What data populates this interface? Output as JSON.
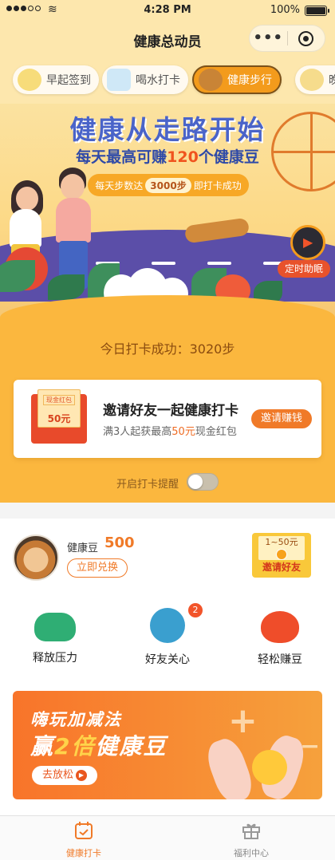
{
  "status_bar": {
    "time": "4:28 PM",
    "battery": "100%"
  },
  "nav": {
    "title": "健康总动员",
    "more_label": "•••"
  },
  "tabs": [
    {
      "label": "早起签到",
      "active": false
    },
    {
      "label": "喝水打卡",
      "active": false
    },
    {
      "label": "健康步行",
      "active": true
    },
    {
      "label": "晚",
      "active": false
    }
  ],
  "banner": {
    "title": "健康从走路开始",
    "sub_prefix": "每天最高可赚",
    "sub_highlight": "120",
    "sub_suffix": "个健康豆",
    "pill_prefix": "每天步数达",
    "pill_steps": "3000步",
    "pill_suffix": "即打卡成功",
    "sleep_label": "定时助眠"
  },
  "checkin": {
    "today_text": "今日打卡成功：3020步"
  },
  "invite_card": {
    "envelope_tag": "现金红包",
    "envelope_value": "50元",
    "title": "邀请好友一起健康打卡",
    "sub_prefix": "满3人起获最高",
    "sub_highlight": "50元",
    "sub_suffix": "现金红包",
    "button": "邀请赚钱"
  },
  "reminder": {
    "label": "开启打卡提醒",
    "enabled": false
  },
  "beans": {
    "label": "健康豆",
    "value": "500",
    "redeem": "立即兑换",
    "invite_range": "1~50元",
    "invite_label": "邀请好友"
  },
  "features": [
    {
      "label": "释放压力",
      "icon": "gamepad-icon",
      "color": "#2fae74"
    },
    {
      "label": "好友关心",
      "icon": "heart-icon",
      "color": "#3a9fcf",
      "badge": "2"
    },
    {
      "label": "轻松赚豆",
      "icon": "bean-icon",
      "color": "#ef4d2a"
    }
  ],
  "promo": {
    "line1": "嗨玩加减法",
    "line2_prefix": "赢",
    "line2_highlight": "2倍",
    "line2_suffix": "健康豆",
    "button": "去放松"
  },
  "tabbar": [
    {
      "label": "健康打卡",
      "icon": "calendar-check-icon",
      "active": true
    },
    {
      "label": "福利中心",
      "icon": "gift-icon",
      "active": false
    }
  ],
  "colors": {
    "accent": "#f07a28",
    "banner_bg": "#fde7ad",
    "orange_bg": "#fbb73e"
  }
}
